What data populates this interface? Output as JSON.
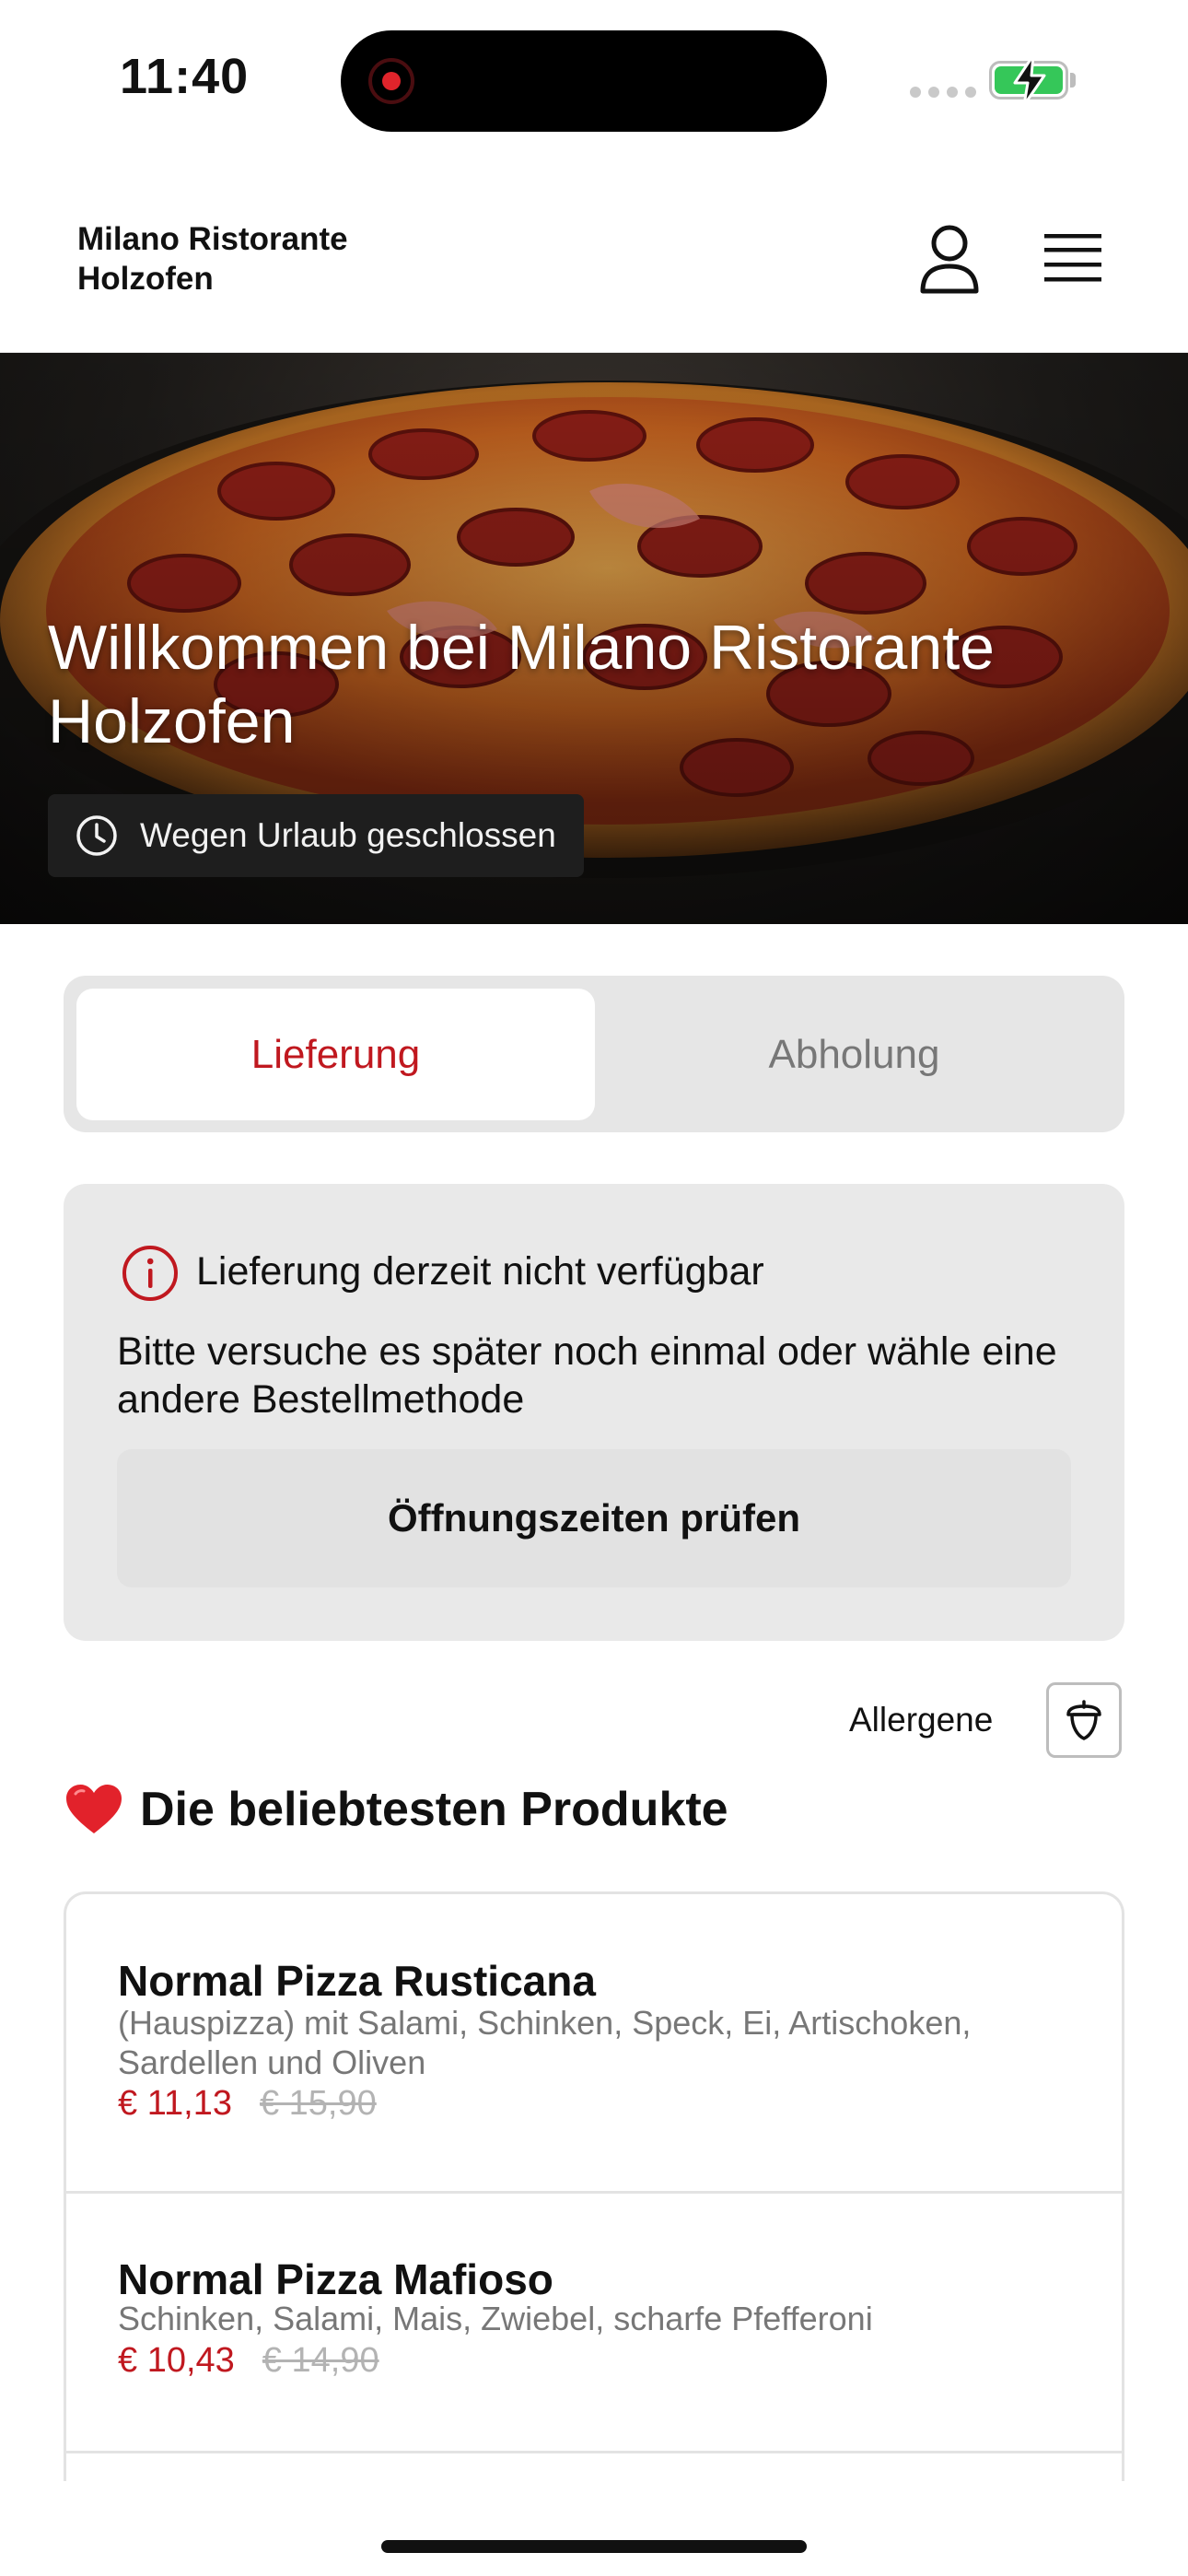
{
  "status_bar": {
    "time": "11:40"
  },
  "header": {
    "brand_line1": "Milano Ristorante",
    "brand_line2": "Holzofen",
    "icons": [
      "account-icon",
      "menu-icon"
    ]
  },
  "hero": {
    "title": "Willkommen bei Milano Ristorante Holzofen",
    "status_label": "Wegen Urlaub geschlossen",
    "status_icon": "clock-icon"
  },
  "order_mode": {
    "tabs": [
      {
        "label": "Lieferung",
        "selected": true
      },
      {
        "label": "Abholung",
        "selected": false
      }
    ]
  },
  "notice": {
    "icon": "info-icon",
    "title": "Lieferung derzeit nicht verfügbar",
    "text": "Bitte versuche es später noch einmal oder wähle eine andere Bestellmethode",
    "button_label": "Öffnungszeiten prüfen"
  },
  "allergens": {
    "label": "Allergene",
    "icon": "acorn-icon"
  },
  "popular": {
    "emoji": "❤️",
    "title": "Die beliebtesten Produkte",
    "products": [
      {
        "name": "Normal Pizza Rusticana",
        "description": "(Hauspizza) mit Salami, Schinken, Speck, Ei, Artischoken, Sardellen und Oliven",
        "price": "€ 11,13",
        "old_price": "€ 15,90"
      },
      {
        "name": "Normal Pizza Mafioso",
        "description": "Schinken, Salami, Mais, Zwiebel, scharfe Pfefferoni",
        "price": "€ 10,43",
        "old_price": "€ 14,90"
      }
    ]
  },
  "colors": {
    "accent": "#c0181f",
    "battery": "#35c759",
    "muted_text": "#777777",
    "panel": "#e9e9e9"
  }
}
